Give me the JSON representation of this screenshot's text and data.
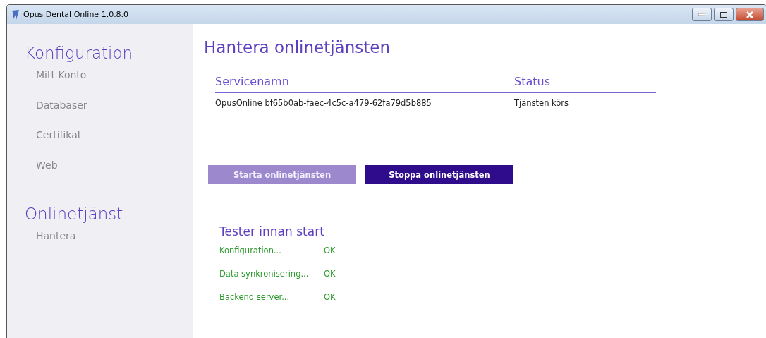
{
  "window": {
    "title": "Opus Dental Online 1.0.8.0"
  },
  "sidebar": {
    "sections": [
      {
        "title": "Konfiguration",
        "items": [
          {
            "label": "Mitt Konto"
          },
          {
            "label": "Databaser"
          },
          {
            "label": "Certifikat"
          },
          {
            "label": "Web"
          }
        ]
      },
      {
        "title": "Onlinetjänst",
        "items": [
          {
            "label": "Hantera"
          }
        ]
      }
    ]
  },
  "main": {
    "title": "Hantera onlinetjänsten",
    "table": {
      "columns": [
        "Servicenamn",
        "Status"
      ],
      "rows": [
        [
          "OpusOnline bf65b0ab-faec-4c5c-a479-62fa79d5b885",
          "Tjänsten körs"
        ]
      ]
    },
    "buttons": [
      {
        "label": "Starta onlinetjänsten",
        "disabled": true
      },
      {
        "label": "Stoppa onlinetjänsten",
        "disabled": false
      }
    ],
    "tests": {
      "title": "Tester innan start",
      "rows": [
        {
          "label": "Konfiguration...",
          "result": "OK"
        },
        {
          "label": "Data synkronisering...",
          "result": "OK"
        },
        {
          "label": "Backend server...",
          "result": "OK"
        }
      ]
    }
  }
}
